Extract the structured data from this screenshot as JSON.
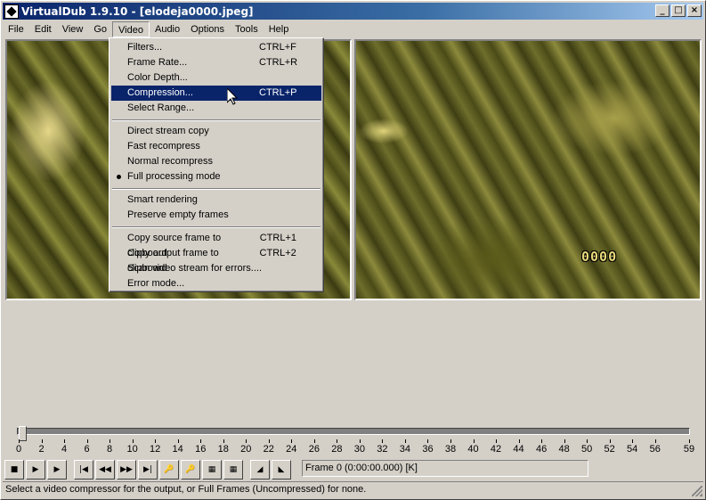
{
  "window": {
    "title": "VirtualDub 1.9.10 - [elodeja0000.jpeg]",
    "controls": {
      "minimize": "_",
      "maximize": "□",
      "close": "×"
    }
  },
  "menubar": [
    {
      "label": "File"
    },
    {
      "label": "Edit"
    },
    {
      "label": "View"
    },
    {
      "label": "Go"
    },
    {
      "label": "Video"
    },
    {
      "label": "Audio"
    },
    {
      "label": "Options"
    },
    {
      "label": "Tools"
    },
    {
      "label": "Help"
    }
  ],
  "video_menu": {
    "groups": [
      [
        {
          "label": "Filters...",
          "shortcut": "CTRL+F"
        },
        {
          "label": "Frame Rate...",
          "shortcut": "CTRL+R"
        },
        {
          "label": "Color Depth...",
          "shortcut": ""
        },
        {
          "label": "Compression...",
          "shortcut": "CTRL+P",
          "highlighted": true
        },
        {
          "label": "Select Range...",
          "shortcut": ""
        }
      ],
      [
        {
          "label": "Direct stream copy",
          "shortcut": ""
        },
        {
          "label": "Fast recompress",
          "shortcut": ""
        },
        {
          "label": "Normal recompress",
          "shortcut": ""
        },
        {
          "label": "Full processing mode",
          "shortcut": "",
          "checked": true
        }
      ],
      [
        {
          "label": "Smart rendering",
          "shortcut": ""
        },
        {
          "label": "Preserve empty frames",
          "shortcut": ""
        }
      ],
      [
        {
          "label": "Copy source frame to clipboard",
          "shortcut": "CTRL+1"
        },
        {
          "label": "Copy output frame to clipboard",
          "shortcut": "CTRL+2"
        },
        {
          "label": "Scan video stream for errors....",
          "shortcut": ""
        },
        {
          "label": "Error mode...",
          "shortcut": ""
        }
      ]
    ]
  },
  "output_pane": {
    "frame_counter": "0000"
  },
  "timeline": {
    "position": 0,
    "min": 0,
    "max": 59,
    "tick_labels": [
      "0",
      "2",
      "4",
      "6",
      "8",
      "10",
      "12",
      "14",
      "16",
      "18",
      "20",
      "22",
      "24",
      "26",
      "28",
      "30",
      "32",
      "34",
      "36",
      "38",
      "40",
      "42",
      "44",
      "46",
      "48",
      "50",
      "52",
      "54",
      "56",
      "59"
    ]
  },
  "toolbar": {
    "buttons": [
      {
        "name": "stop-icon",
        "glyph": "■"
      },
      {
        "name": "play-input-icon",
        "glyph": "▶"
      },
      {
        "name": "play-output-icon",
        "glyph": "▶"
      },
      {
        "name": "go-start-icon",
        "glyph": "|◀"
      },
      {
        "name": "step-back-icon",
        "glyph": "◀◀"
      },
      {
        "name": "step-forward-icon",
        "glyph": "▶▶"
      },
      {
        "name": "go-end-icon",
        "glyph": "▶|"
      },
      {
        "name": "prev-keyframe-icon",
        "glyph": "🔑"
      },
      {
        "name": "next-keyframe-icon",
        "glyph": "🔑"
      },
      {
        "name": "prev-scene-icon",
        "glyph": "▦"
      },
      {
        "name": "next-scene-icon",
        "glyph": "▦"
      },
      {
        "name": "mark-in-icon",
        "glyph": "◢"
      },
      {
        "name": "mark-out-icon",
        "glyph": "◣"
      }
    ],
    "frame_display": "Frame 0 (0:00:00.000) [K]"
  },
  "statusbar": {
    "text": "Select a video compressor for the output, or Full Frames (Uncompressed) for none."
  },
  "colors": {
    "titlebar": "#0a246a",
    "menu_highlight": "#0a246a",
    "face": "#d4d0c8"
  }
}
